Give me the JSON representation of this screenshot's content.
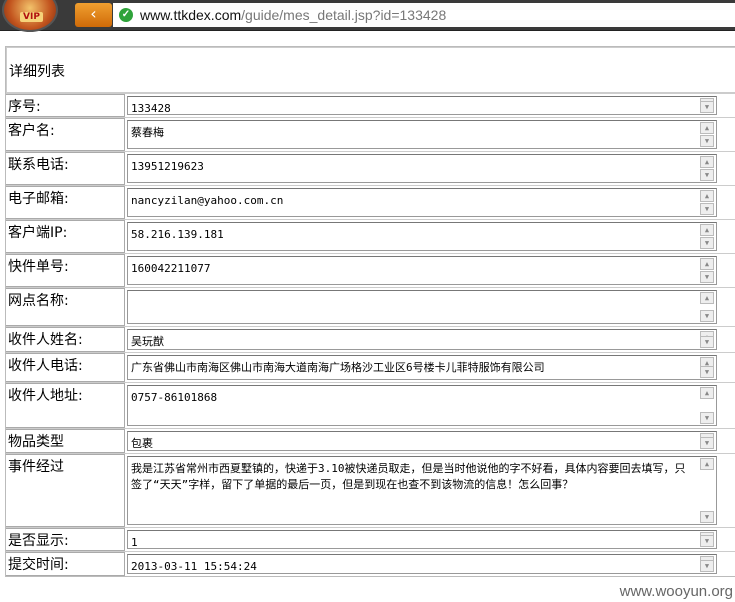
{
  "browser": {
    "logo_text": "VIP",
    "url_host": "www.ttkdex.com",
    "url_path": "/guide/mes_detail.jsp?id=133428"
  },
  "page": {
    "title": "详细列表"
  },
  "rows": [
    {
      "label": "序号:",
      "value": "133428"
    },
    {
      "label": "客户名:",
      "value": "蔡春梅"
    },
    {
      "label": "联系电话:",
      "value": "13951219623"
    },
    {
      "label": "电子邮箱:",
      "value": "nancyzilan@yahoo.com.cn"
    },
    {
      "label": "客户端IP:",
      "value": "58.216.139.181"
    },
    {
      "label": "快件单号:",
      "value": "160042211077"
    },
    {
      "label": "网点名称:",
      "value": ""
    },
    {
      "label": "收件人姓名:",
      "value": "吴玩猷"
    },
    {
      "label": "收件人电话:",
      "value": "广东省佛山市南海区佛山市南海大道南海广场格沙工业区6号楼卡儿菲特服饰有限公司"
    },
    {
      "label": "收件人地址:",
      "value": "0757-86101868"
    },
    {
      "label": "物品类型",
      "value": "包裹"
    },
    {
      "label": "事件经过",
      "value": "我是江苏省常州市西夏墅镇的，快递于3.10被快递员取走，但是当时他说他的字不好看，具体内容要回去填写，只签了“天天”字样，留下了单据的最后一页，但是到现在也查不到该物流的信息！怎么回事？"
    },
    {
      "label": "是否显示:",
      "value": "1"
    },
    {
      "label": "提交时间:",
      "value": "2013-03-11 15:54:24"
    }
  ],
  "watermark": "www.wooyun.org"
}
